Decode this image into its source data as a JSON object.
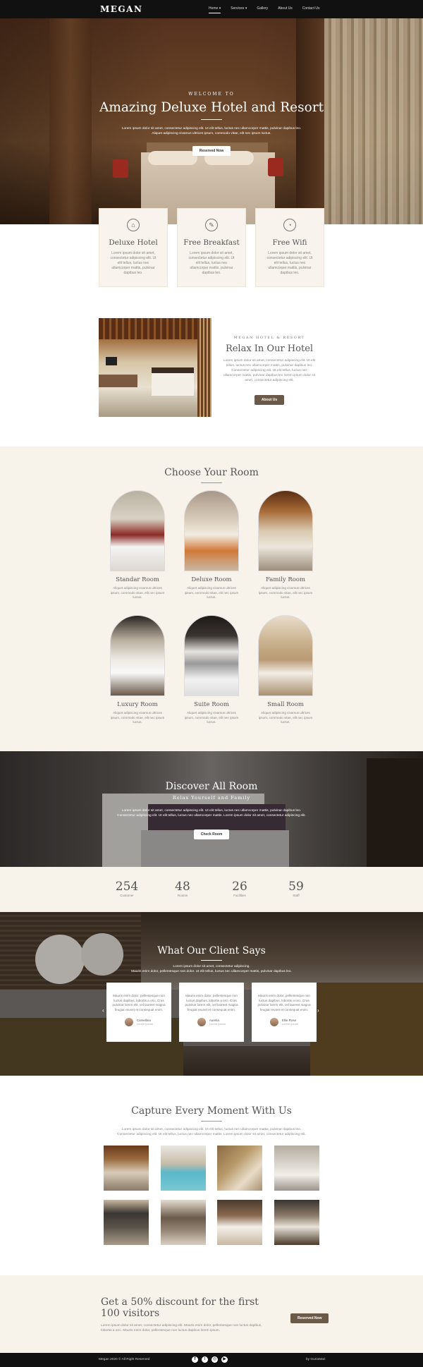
{
  "nav": {
    "logo": "MEGAN",
    "items": [
      "Home",
      "Services",
      "Gallery",
      "About Us",
      "Contact Us"
    ],
    "active": "Home"
  },
  "hero": {
    "eyebrow": "WELCOME TO",
    "title": "Amazing Deluxe Hotel and Resort",
    "text1": "Lorem ipsum dolor sit amet, consectetur adipiscing elit. Ut elit tellus, luctus nec ullamcorper mattis, pulvinar dapibus leo.",
    "text2": "Aliquet adipiscing vivamus ultrices ipsum, commodo vitae, elit nec ipsum luctus.",
    "button": "Reserved Now"
  },
  "features": [
    {
      "icon": "hotel-icon",
      "title": "Deluxe Hotel",
      "text": "Lorem ipsum dolor sit amet, consectetur adipiscing elit. Ut elit tellus, luctus nec ullamcorper mattis, pulvinar dapibus leo."
    },
    {
      "icon": "breakfast-icon",
      "title": "Free Breakfast",
      "text": "Lorem ipsum dolor sit amet, consectetur adipiscing elit. Ut elit tellus, luctus nec ullamcorper mattis, pulvinar dapibus leo."
    },
    {
      "icon": "wifi-icon",
      "title": "Free Wifi",
      "text": "Lorem ipsum dolor sit amet, consectetur adipiscing elit. Ut elit tellus, luctus nec ullamcorper mattis, pulvinar dapibus leo."
    }
  ],
  "relax": {
    "eyebrow": "MEGAN HOTEL & RESORT",
    "title": "Relax In Our Hotel",
    "text": "Lorem ipsum dolor sit amet, consectetur adipiscing elit. Ut elit tellus, luctus nec ullamcorper mattis, pulvinar dapibus leo. Consectetur adipiscing elit. Ut elit tellus, luctus nec ullamcorper mattis, pulvinar dapibus leo lorem ipsum dolor sit amet, consectetur adipiscing elit.",
    "button": "About Us"
  },
  "rooms": {
    "title": "Choose Your Room",
    "items": [
      {
        "name": "Standar Room",
        "text": "Aliquet adipiscing vivamus ultrices ipsum, commodo vitae, elit nec ipsum luctus."
      },
      {
        "name": "Deluxe Room",
        "text": "Aliquet adipiscing vivamus ultrices ipsum, commodo vitae, elit nec ipsum luctus."
      },
      {
        "name": "Family Room",
        "text": "Aliquet adipiscing vivamus ultrices ipsum, commodo vitae, elit nec ipsum luctus."
      },
      {
        "name": "Luxury Room",
        "text": "Aliquet adipiscing vivamus ultrices ipsum, commodo vitae, elit nec ipsum luctus."
      },
      {
        "name": "Suite Room",
        "text": "Aliquet adipiscing vivamus ultrices ipsum, commodo vitae, elit nec ipsum luctus."
      },
      {
        "name": "Small Room",
        "text": "Aliquet adipiscing vivamus ultrices ipsum, commodo vitae, elit nec ipsum luctus."
      }
    ]
  },
  "discover": {
    "title": "Discover All Room",
    "subtitle": "Relax Yourself and Family",
    "text1": "Lorem ipsum dolor sit amet, consectetur adipiscing elit. Ut elit tellus, luctus nec ullamcorper mattis, pulvinar dapibus leo.",
    "text2": "Consectetur adipiscing elit. Ut elit tellus, luctus nec ullamcorper mattis. Lorem ipsum dolor sit amet, consectetur adipiscing elit.",
    "button": "Check Room"
  },
  "stats": [
    {
      "n": "254",
      "l": "Customer"
    },
    {
      "n": "48",
      "l": "Rooms"
    },
    {
      "n": "26",
      "l": "Facilities"
    },
    {
      "n": "59",
      "l": "Staff"
    }
  ],
  "testimonials": {
    "title": "What Our Client Says",
    "text1": "Lorem ipsum dolor sit amet, consectetur adipiscing.",
    "text2": "Mauris enim dolor, pellentesque non dolor. Ut elit tellus, luctus nec ullamcorper mattis, pulvinar dapibus leo.",
    "cards": [
      {
        "quote": "Mauris enim dolor, pellentesque non luctus dapibus, lobortis a orci. Cras pulvinar lorem elit, vel laoreet magna feugiat reunet et consequat enim.",
        "name": "Camellina",
        "role": "Lorem Ipsum"
      },
      {
        "quote": "Mauris enim dolor, pellentesque non luctus dapibus, lobortis a orci. Cras pulvinar lorem elit, vel laoreet magna feugiat reunet et consequat enim.",
        "name": "Aurelia",
        "role": "Lorem Ipsum"
      },
      {
        "quote": "Mauris enim dolor, pellentesque non luctus dapibus, lobortis a orci. Cras pulvinar lorem elit, vel laoreet magna feugiat reunet et consequat enim.",
        "name": "Ellie Rose",
        "role": "Lorem Ipsum"
      }
    ]
  },
  "gallery": {
    "title": "Capture Every Moment With Us",
    "text1": "Lorem ipsum dolor sit amet, consectetur adipiscing elit. Ut elit tellus, luctus nec ullamcorper mattis, pulvinar dapibus leo.",
    "text2": "Consectetur adipiscing elit. Ut elit tellus, luctus nec ullamcorper mattis. Lorem ipsum dolor sit amet, consectetur adipiscing elit."
  },
  "promo": {
    "title": "Get a 50% discount for the first 100 visitors",
    "text": "Lorem ipsum dolor sit amet, consectetur adipiscing elit. Mauris enim dolor, pellentesque non luctus dapibus, lobortis a orci. Mauris enim dolor, pellentesque non luctus dapibus lorem ipsum.",
    "button": "Reserved Now"
  },
  "footer": {
    "copy": "Megan 2020 © All Right Reserved",
    "credit": "by GurioMari",
    "social": [
      "facebook-icon",
      "twitter-icon",
      "instagram-icon",
      "youtube-icon"
    ]
  }
}
